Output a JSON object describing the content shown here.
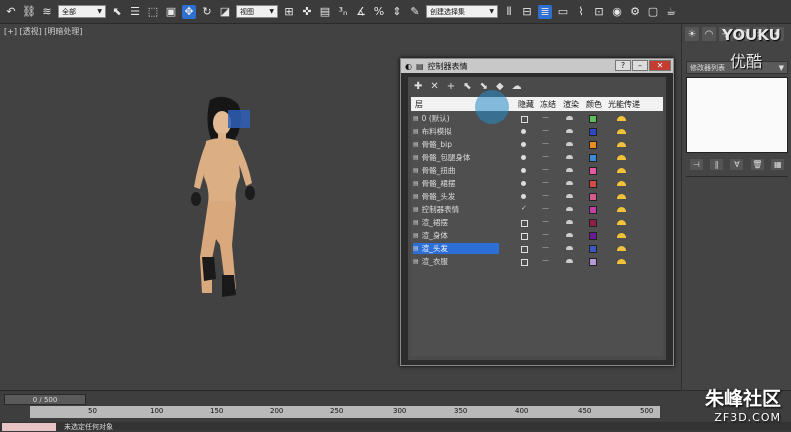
{
  "toolbar": {
    "selection_filter": "全部",
    "ref_coord": "视图",
    "named_selection": "创建选择集"
  },
  "viewport": {
    "label": "[+] [透视] [明暗处理]"
  },
  "command_panel": {
    "modifier_list": "修改器列表"
  },
  "watermark_top": {
    "brand": "YOUKU",
    "brand_cn": "优酷"
  },
  "dialog": {
    "title": "控制器表情",
    "columns": [
      "层",
      "隐藏",
      "冻结",
      "渲染",
      "颜色",
      "光能传递"
    ],
    "rows": [
      {
        "name": "0 (默认)",
        "hidden": "box",
        "frozen": "—",
        "color": "#5cbf5c",
        "selected": false
      },
      {
        "name": "布料模拟",
        "hidden": "bulb",
        "frozen": "—",
        "color": "#2c49c2",
        "selected": false
      },
      {
        "name": "骨骼_bip",
        "hidden": "bulb",
        "frozen": "—",
        "color": "#e88d24",
        "selected": false
      },
      {
        "name": "骨骼_包腿身体",
        "hidden": "bulb",
        "frozen": "—",
        "color": "#3a8ad6",
        "selected": false
      },
      {
        "name": "骨骼_扭曲",
        "hidden": "bulb",
        "frozen": "—",
        "color": "#e65aa4",
        "selected": false
      },
      {
        "name": "骨骼_裙摆",
        "hidden": "bulb",
        "frozen": "—",
        "color": "#d64a4a",
        "selected": false
      },
      {
        "name": "骨骼_头发",
        "hidden": "bulb",
        "frozen": "—",
        "color": "#d65a8a",
        "selected": false
      },
      {
        "name": "控制器表情",
        "hidden": "check",
        "frozen": "—",
        "color": "#c43fa8",
        "selected": false
      },
      {
        "name": "渲_裙摆",
        "hidden": "box",
        "frozen": "—",
        "color": "#8f1f49",
        "selected": false
      },
      {
        "name": "渲_身体",
        "hidden": "box",
        "frozen": "—",
        "color": "#6a1a96",
        "selected": false
      },
      {
        "name": "渲_头发",
        "hidden": "box",
        "frozen": "—",
        "color": "#3c56c2",
        "selected": true
      },
      {
        "name": "渲_衣服",
        "hidden": "box",
        "frozen": "—",
        "color": "#b49ad6",
        "selected": false
      }
    ]
  },
  "timeline": {
    "frame_display": "0 / 500",
    "ticks": [
      "50",
      "100",
      "150",
      "200",
      "250",
      "300",
      "350",
      "400",
      "450",
      "500"
    ]
  },
  "status": {
    "text": "未选定任何对象"
  },
  "watermark": {
    "brand": "朱峰社区",
    "domain": "ZF3D.COM"
  }
}
